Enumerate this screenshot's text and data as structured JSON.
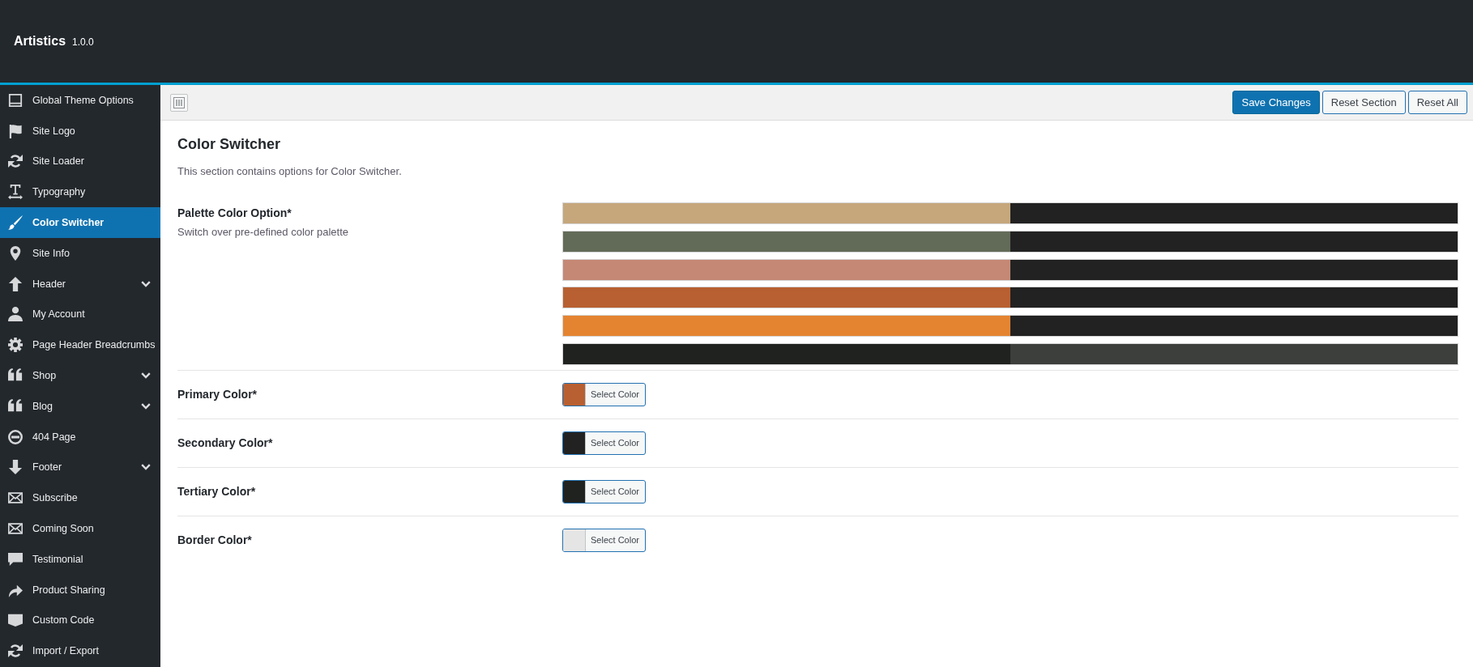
{
  "header": {
    "title": "Artistics",
    "version": "1.0.0"
  },
  "sidebar": {
    "items": [
      {
        "label": "Global Theme Options",
        "selected": false,
        "expandable": false
      },
      {
        "label": "Site Logo",
        "selected": false,
        "expandable": false
      },
      {
        "label": "Site Loader",
        "selected": false,
        "expandable": false
      },
      {
        "label": "Typography",
        "selected": false,
        "expandable": false
      },
      {
        "label": "Color Switcher",
        "selected": true,
        "expandable": false
      },
      {
        "label": "Site Info",
        "selected": false,
        "expandable": false
      },
      {
        "label": "Header",
        "selected": false,
        "expandable": true
      },
      {
        "label": "My Account",
        "selected": false,
        "expandable": false
      },
      {
        "label": "Page Header Breadcrumbs",
        "selected": false,
        "expandable": false
      },
      {
        "label": "Shop",
        "selected": false,
        "expandable": true
      },
      {
        "label": "Blog",
        "selected": false,
        "expandable": true
      },
      {
        "label": "404 Page",
        "selected": false,
        "expandable": false
      },
      {
        "label": "Footer",
        "selected": false,
        "expandable": true
      },
      {
        "label": "Subscribe",
        "selected": false,
        "expandable": false
      },
      {
        "label": "Coming Soon",
        "selected": false,
        "expandable": false
      },
      {
        "label": "Testimonial",
        "selected": false,
        "expandable": false
      },
      {
        "label": "Product Sharing",
        "selected": false,
        "expandable": false
      },
      {
        "label": "Custom Code",
        "selected": false,
        "expandable": false
      },
      {
        "label": "Import / Export",
        "selected": false,
        "expandable": false
      }
    ]
  },
  "toolbar": {
    "buttons": [
      {
        "label": "Save Changes",
        "kind": "primary"
      },
      {
        "label": "Reset Section",
        "kind": "secondary"
      },
      {
        "label": "Reset All",
        "kind": "secondary"
      }
    ]
  },
  "section": {
    "title": "Color Switcher",
    "description": "This section contains options for Color Switcher.",
    "fields": [
      {
        "kind": "palette",
        "label": "Palette Color Option*",
        "description": "Switch over pre-defined color palette",
        "palettes": [
          {
            "swatches": [
              {
                "color": "#c6a77c"
              },
              {
                "color": "#222222"
              }
            ]
          },
          {
            "swatches": [
              {
                "color": "#626b58"
              },
              {
                "color": "#222222"
              }
            ]
          },
          {
            "swatches": [
              {
                "color": "#c58875"
              },
              {
                "color": "#222222"
              }
            ]
          },
          {
            "swatches": [
              {
                "color": "#b86031"
              },
              {
                "color": "#222222"
              }
            ]
          },
          {
            "swatches": [
              {
                "color": "#e48431"
              },
              {
                "color": "#222222"
              }
            ]
          },
          {
            "swatches": [
              {
                "color": "#202220"
              },
              {
                "color": "#3d3f3d"
              }
            ]
          }
        ]
      },
      {
        "kind": "color",
        "label": "Primary Color*",
        "color": "#b86031",
        "button": "Select Color"
      },
      {
        "kind": "color",
        "label": "Secondary Color*",
        "color": "#222222",
        "button": "Select Color"
      },
      {
        "kind": "color",
        "label": "Tertiary Color*",
        "color": "#202220",
        "button": "Select Color"
      },
      {
        "kind": "color",
        "label": "Border Color*",
        "color": "#e5e5e5",
        "button": "Select Color"
      }
    ]
  }
}
